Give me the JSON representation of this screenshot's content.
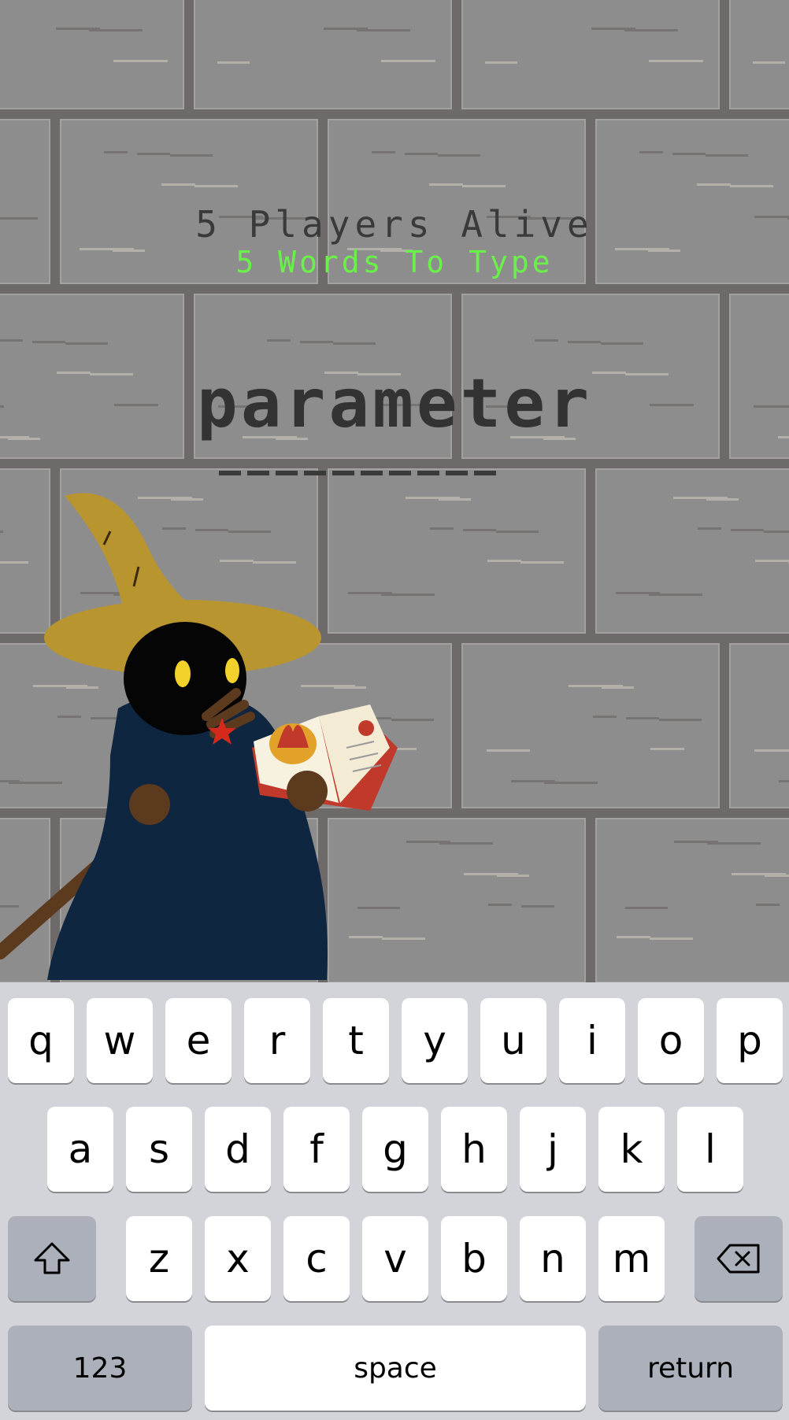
{
  "hud": {
    "players_alive": "5 Players Alive",
    "words_to_type": "5 Words To Type"
  },
  "target": {
    "word": "parameter",
    "slots": 10
  },
  "keyboard": {
    "row1": [
      "q",
      "w",
      "e",
      "r",
      "t",
      "y",
      "u",
      "i",
      "o",
      "p"
    ],
    "row2": [
      "a",
      "s",
      "d",
      "f",
      "g",
      "h",
      "j",
      "k",
      "l"
    ],
    "row3": [
      "z",
      "x",
      "c",
      "v",
      "b",
      "n",
      "m"
    ],
    "numbers_label": "123",
    "space_label": "space",
    "return_label": "return",
    "shift_icon": "shift-arrow-icon",
    "delete_icon": "backspace-icon"
  },
  "colors": {
    "wall": "#8e8d8d",
    "brick_line": "#6e6a6a",
    "words_accent": "#6bf04b",
    "keyboard_bg": "#d2d4d9",
    "robe": "#0f2640",
    "hat": "#b8952f"
  }
}
